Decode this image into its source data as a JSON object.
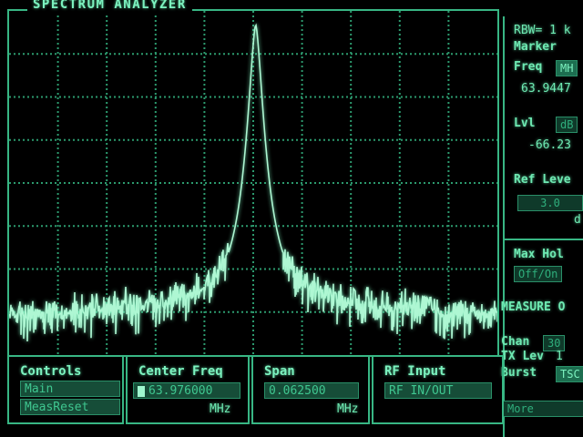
{
  "header": {
    "title": "SPECTRUM ANALYZER"
  },
  "grid": {
    "columns": 10,
    "rows": 8
  },
  "trace": {
    "peak_position": 0.505,
    "peak_level": 0.96,
    "noise_floor_level": 0.1,
    "color": "#aef7d3"
  },
  "right_panel": {
    "rbw": "RBW= 1 k",
    "marker_title": "Marker",
    "freq_label": "Freq",
    "freq_unit_tag": "MH",
    "freq_value": "63.9447",
    "lvl_label": "Lvl",
    "lvl_unit_tag": "dB",
    "lvl_value": "-66.23",
    "ref_level_label": "Ref Leve",
    "ref_level_value": "3.0",
    "ref_level_unit": "d",
    "max_hold_label": "Max Hol",
    "max_hold_toggle": "Off/On",
    "measure_label": "MEASURE O",
    "chan_label": "Chan",
    "chan_value": "30",
    "tx_lev_label": "TX Lev",
    "tx_lev_value": "1",
    "burst_label": "Burst",
    "burst_value": "TSC",
    "more_label": "More"
  },
  "softkeys": {
    "controls": {
      "label": "Controls",
      "main": "Main",
      "meas_reset": "MeasReset"
    },
    "center_freq": {
      "label": "Center Freq",
      "value": "63.976000",
      "unit": "MHz"
    },
    "span": {
      "label": "Span",
      "value": "0.062500",
      "unit": "MHz"
    },
    "rf_input": {
      "label": "RF Input",
      "value": "RF IN/OUT"
    }
  }
}
